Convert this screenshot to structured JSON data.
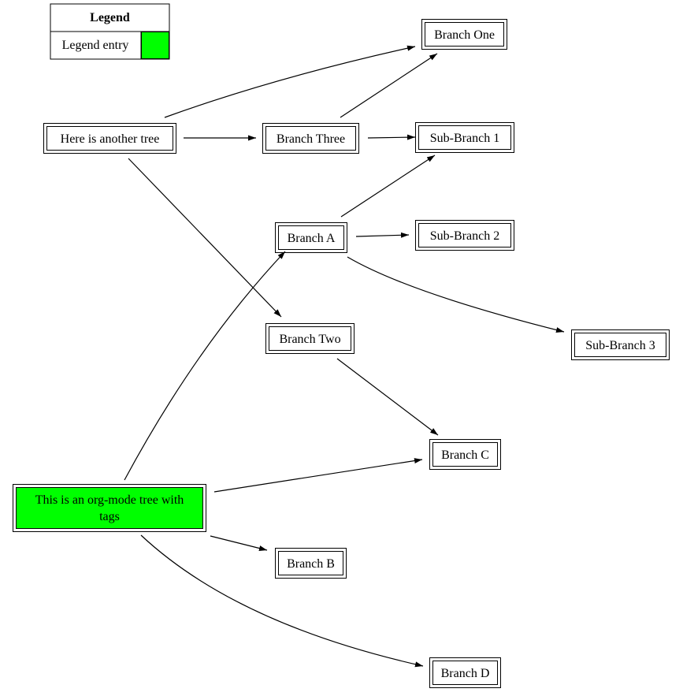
{
  "legend": {
    "title": "Legend",
    "entry_label": "Legend entry",
    "entry_color": "#00ff00"
  },
  "nodes": {
    "another_tree": "Here is another tree",
    "branch_three": "Branch Three",
    "branch_one": "Branch One",
    "sub_branch_1": "Sub-Branch 1",
    "branch_a": "Branch A",
    "sub_branch_2": "Sub-Branch 2",
    "sub_branch_3": "Sub-Branch 3",
    "branch_two": "Branch Two",
    "branch_c": "Branch C",
    "org_tree_line1": "This is an org-mode tree with",
    "org_tree_line2": "tags",
    "branch_b": "Branch B",
    "branch_d": "Branch D"
  },
  "colors": {
    "tagged_node_fill": "#00ff00",
    "stroke": "#000000"
  },
  "edges": [
    {
      "from": "Here is another tree",
      "to": "Branch One"
    },
    {
      "from": "Here is another tree",
      "to": "Branch Three"
    },
    {
      "from": "Here is another tree",
      "to": "Branch Two"
    },
    {
      "from": "Branch Three",
      "to": "Branch One"
    },
    {
      "from": "Branch Three",
      "to": "Sub-Branch 1"
    },
    {
      "from": "Branch A",
      "to": "Sub-Branch 1"
    },
    {
      "from": "Branch A",
      "to": "Sub-Branch 2"
    },
    {
      "from": "Branch A",
      "to": "Sub-Branch 3"
    },
    {
      "from": "Branch Two",
      "to": "Branch C"
    },
    {
      "from": "This is an org-mode tree with tags",
      "to": "Branch A"
    },
    {
      "from": "This is an org-mode tree with tags",
      "to": "Branch C"
    },
    {
      "from": "This is an org-mode tree with tags",
      "to": "Branch B"
    },
    {
      "from": "This is an org-mode tree with tags",
      "to": "Branch D"
    }
  ]
}
